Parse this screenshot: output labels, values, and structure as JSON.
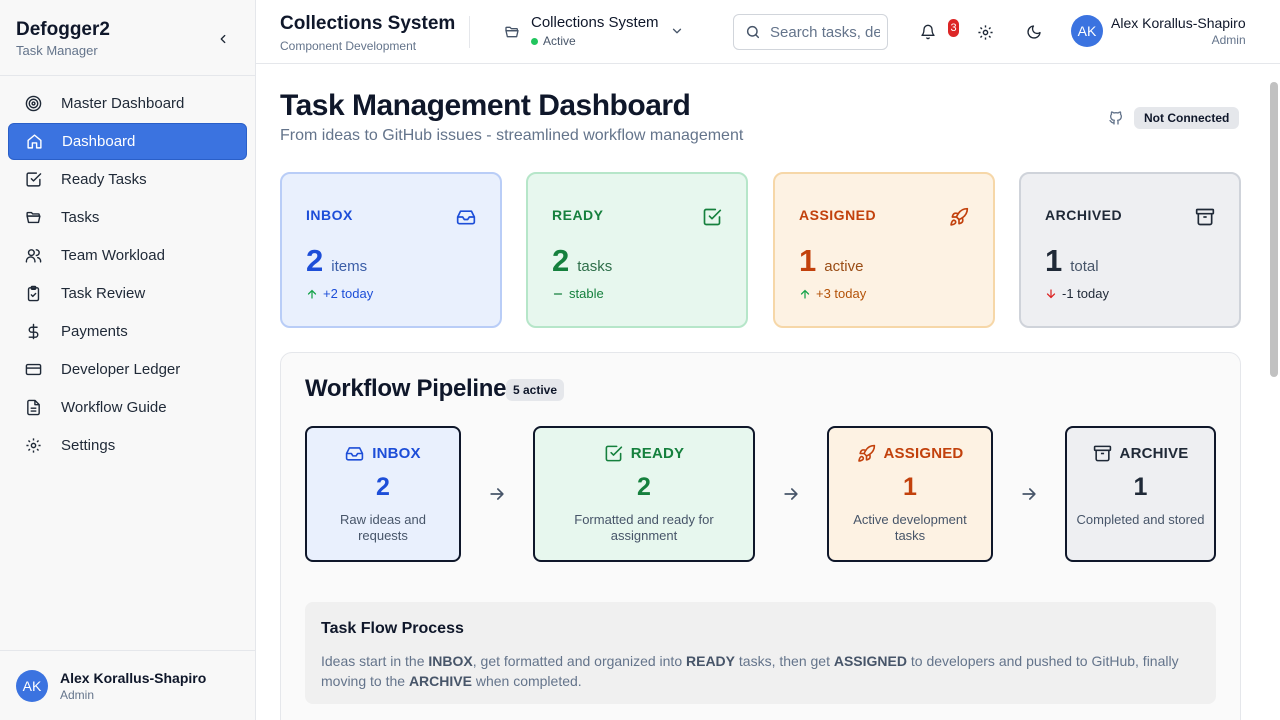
{
  "sidebar": {
    "brand_title": "Defogger2",
    "brand_subtitle": "Task Manager",
    "items": [
      {
        "label": "Master Dashboard",
        "icon": "target-icon",
        "active": false
      },
      {
        "label": "Dashboard",
        "icon": "home-icon",
        "active": true
      },
      {
        "label": "Ready Tasks",
        "icon": "checkbox-icon",
        "active": false
      },
      {
        "label": "Tasks",
        "icon": "folder-icon",
        "active": false
      },
      {
        "label": "Team Workload",
        "icon": "users-icon",
        "active": false
      },
      {
        "label": "Task Review",
        "icon": "clipboard-check-icon",
        "active": false
      },
      {
        "label": "Payments",
        "icon": "dollar-icon",
        "active": false
      },
      {
        "label": "Developer Ledger",
        "icon": "credit-card-icon",
        "active": false
      },
      {
        "label": "Workflow Guide",
        "icon": "document-icon",
        "active": false
      },
      {
        "label": "Settings",
        "icon": "gear-icon",
        "active": false
      }
    ],
    "user": {
      "initials": "AK",
      "name": "Alex Korallus-Shapiro",
      "role": "Admin"
    }
  },
  "header": {
    "title": "Collections System",
    "subtitle": "Component Development",
    "project": {
      "name": "Collections System",
      "status": "Active"
    },
    "search_placeholder": "Search tasks, de",
    "notification_count": "3",
    "user": {
      "initials": "AK",
      "name": "Alex Korallus-Shapiro",
      "role": "Admin"
    }
  },
  "main": {
    "title": "Task Management Dashboard",
    "subtitle": "From ideas to GitHub issues - streamlined workflow management",
    "github_status": "Not Connected",
    "stats": [
      {
        "label": "INBOX",
        "value": "2",
        "unit": "items",
        "trend": "+2 today",
        "trend_dir": "up",
        "icon": "inbox-icon"
      },
      {
        "label": "READY",
        "value": "2",
        "unit": "tasks",
        "trend": "stable",
        "trend_dir": "flat",
        "icon": "checkbox-icon"
      },
      {
        "label": "ASSIGNED",
        "value": "1",
        "unit": "active",
        "trend": "+3 today",
        "trend_dir": "up",
        "icon": "rocket-icon"
      },
      {
        "label": "ARCHIVED",
        "value": "1",
        "unit": "total",
        "trend": "-1 today",
        "trend_dir": "down",
        "icon": "archive-icon"
      }
    ],
    "pipeline": {
      "title": "Workflow Pipeline",
      "badge": "5 active",
      "stages": [
        {
          "label": "INBOX",
          "value": "2",
          "desc": "Raw ideas and requests"
        },
        {
          "label": "READY",
          "value": "2",
          "desc": "Formatted and ready for assignment"
        },
        {
          "label": "ASSIGNED",
          "value": "1",
          "desc": "Active development tasks"
        },
        {
          "label": "ARCHIVE",
          "value": "1",
          "desc": "Completed and stored"
        }
      ],
      "flow": {
        "title": "Task Flow Process",
        "text_1": "Ideas start in the ",
        "kw_1": "INBOX",
        "text_2": ", get formatted and organized into ",
        "kw_2": "READY",
        "text_3": " tasks, then get ",
        "kw_3": "ASSIGNED",
        "text_4": " to developers and pushed to GitHub, finally moving to the ",
        "kw_4": "ARCHIVE",
        "text_5": " when completed."
      }
    }
  },
  "colors": {
    "accent": "#3b73e0",
    "inbox": "#1d4ed8",
    "ready": "#15803d",
    "assigned": "#c2410c",
    "archived": "#1f2937",
    "notification": "#dc2626"
  }
}
